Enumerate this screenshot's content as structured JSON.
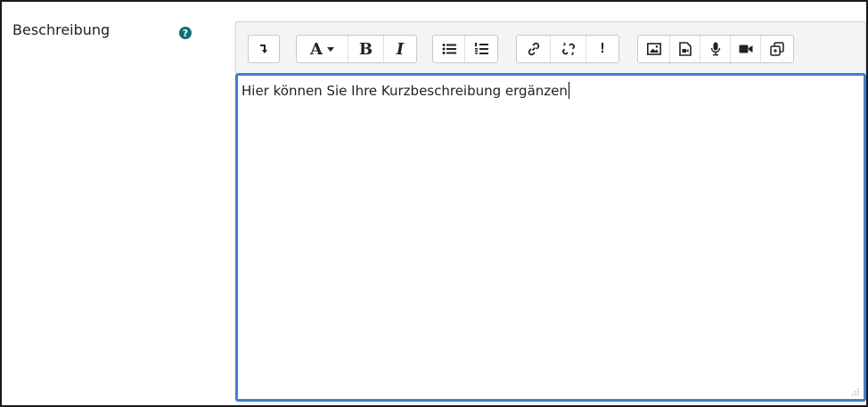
{
  "field": {
    "label": "Beschreibung",
    "help_glyph": "?"
  },
  "toolbar": {
    "groups": [
      [
        {
          "name": "collapse-icon"
        }
      ],
      [
        {
          "name": "font-style-dropdown",
          "label": "A"
        },
        {
          "name": "bold",
          "label": "B"
        },
        {
          "name": "italic",
          "label": "I"
        }
      ],
      [
        {
          "name": "unordered-list-icon"
        },
        {
          "name": "ordered-list-icon"
        }
      ],
      [
        {
          "name": "link-icon"
        },
        {
          "name": "unlink-icon"
        },
        {
          "name": "no-autolink-icon",
          "label": "!"
        }
      ],
      [
        {
          "name": "image-icon"
        },
        {
          "name": "media-icon"
        },
        {
          "name": "record-audio-icon"
        },
        {
          "name": "record-video-icon"
        },
        {
          "name": "h5p-icon"
        }
      ]
    ]
  },
  "editor": {
    "content": "Hier können Sie Ihre Kurzbeschreibung ergänzen"
  },
  "colors": {
    "focus_border": "#3f7fd0",
    "help_icon": "#0f6e7a",
    "toolbar_bg": "#f4f4f4"
  }
}
